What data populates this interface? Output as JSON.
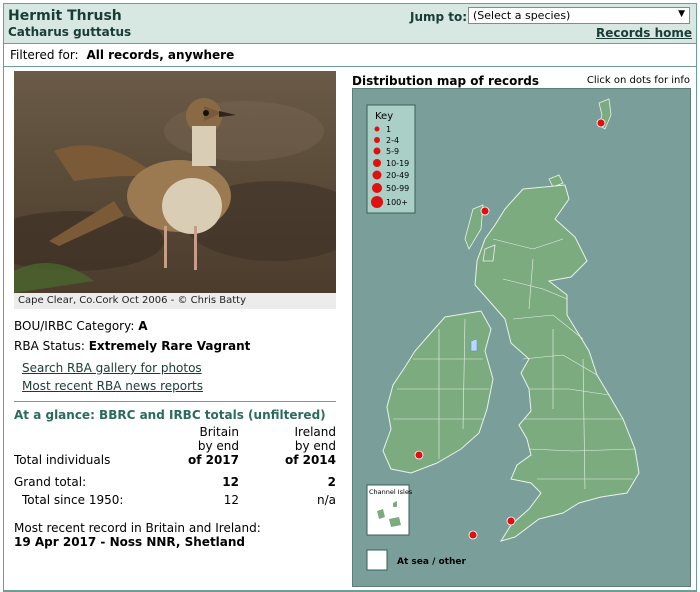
{
  "header": {
    "species": "Hermit Thrush",
    "latin": "Catharus guttatus",
    "jump_label": "Jump to:",
    "jump_placeholder": "(Select a species)",
    "records_home": "Records home"
  },
  "filter": {
    "label": "Filtered for:",
    "value": "All records, anywhere"
  },
  "photo": {
    "caption": "Cape Clear, Co.Cork Oct 2006 - © Chris Batty"
  },
  "info": {
    "category_label": "BOU/IRBC Category:",
    "category_value": "A",
    "status_label": "RBA Status:",
    "status_value": "Extremely Rare Vagrant",
    "link_gallery": "Search RBA gallery for photos",
    "link_news": "Most recent RBA news reports"
  },
  "glance": {
    "title": "At a glance: BBRC and IRBC totals (unfiltered)",
    "col_britain": [
      "Britain",
      "by end",
      "of 2017"
    ],
    "col_ireland": [
      "Ireland",
      "by end",
      "of 2014"
    ],
    "row_individuals": "Total individuals",
    "grand_total_label": "Grand total:",
    "grand_total_britain": "12",
    "grand_total_ireland": "2",
    "since1950_label": "Total since 1950:",
    "since1950_britain": "12",
    "since1950_ireland": "n/a"
  },
  "recent": {
    "label": "Most recent record in Britain and Ireland:",
    "value": "19 Apr 2017  - Noss NNR, Shetland"
  },
  "map": {
    "title": "Distribution map of records",
    "hint": "Click on dots for info",
    "key_title": "Key",
    "key_items": [
      "1",
      "2-4",
      "5-9",
      "10-19",
      "20-49",
      "50-99",
      "100+"
    ],
    "channel_islands": "Channel Isles",
    "at_sea": "At sea / other",
    "land_color": "#7cab80",
    "sea_color": "#7a9f9a",
    "dot_color": "#e01010"
  }
}
